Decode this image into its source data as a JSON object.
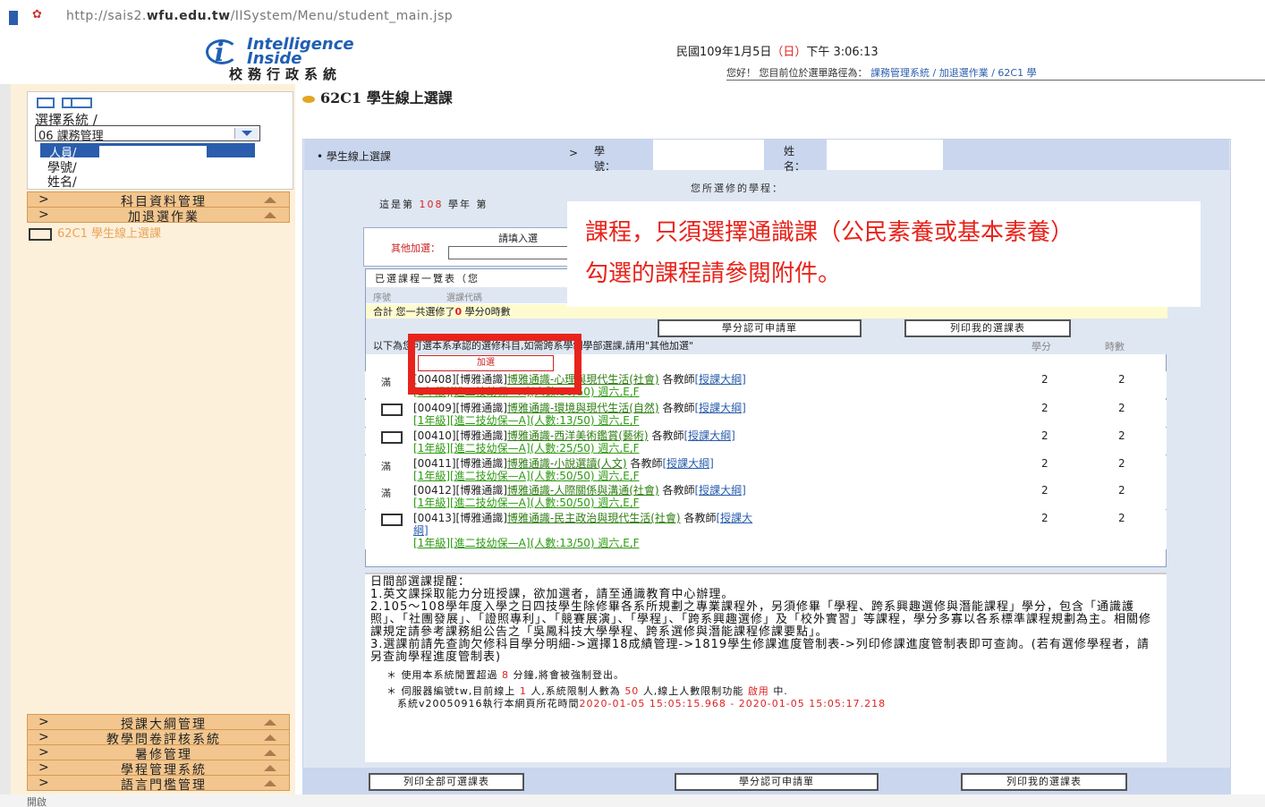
{
  "address_bar": {
    "url_prefix": "http://sais2.",
    "url_domain": "wfu.edu.tw",
    "url_suffix": "/IISystem/Menu/student_main.jsp"
  },
  "header": {
    "logo_line1": "Intelligence",
    "logo_line2": "Inside",
    "system_name": "校務行政系統",
    "date": "民國109年1月5日",
    "weekday": "（日）",
    "time": "下午 3:06:13",
    "path_label": "您好！ 您目前位於選單路徑為：",
    "path": "課務管理系統 / 加退選作業 / 62C1 學"
  },
  "sidebar": {
    "select_label": "選擇系統 /",
    "selected_system": "06 課務管理",
    "user_line": "人員/",
    "student_no_label": "學號/",
    "name_label": "姓名/",
    "menus_top": [
      {
        "arrow": ">",
        "label": "科目資料管理"
      },
      {
        "arrow": ">",
        "label": "加退選作業"
      }
    ],
    "sub_item": "62C1 學生線上選課",
    "menus_bottom": [
      {
        "arrow": ">",
        "label": "授課大綱管理"
      },
      {
        "arrow": ">",
        "label": "教學問卷評核系統"
      },
      {
        "arrow": ">",
        "label": "暑修管理"
      },
      {
        "arrow": ">",
        "label": "學程管理系統"
      },
      {
        "arrow": ">",
        "label": "語言門檻管理"
      }
    ]
  },
  "main": {
    "title": "62C1 學生線上選課",
    "bar_label": "• 學生線上選課",
    "bar_arrow": ">",
    "student_no_label": "學 號：",
    "student_name_label": "姓 名：",
    "intro_line1": "您所選修的學程：",
    "intro_prefix": "這是第",
    "intro_year": "108",
    "intro_mid": "學年  第",
    "other_add_hint": "請填入選",
    "other_add_label": "其他加選：",
    "callout_line1": "課程，只須選擇通識課（公民素養或基本素養）",
    "callout_line2": "勾選的課程請參閱附件。",
    "selected_header": "已選課程一覽表（您",
    "col_no": "序號",
    "col_code": "選課代碼",
    "total_prefix": "合計 您一共選修了",
    "total_credit": "0",
    "total_suffix": "學分0時數",
    "btn_print_all": "列印全部可選課表",
    "btn_credit_apply": "學分認可申請單",
    "btn_print_mine": "列印我的選課表",
    "list_header": "以下為您可選本系承認的選修科目,如需跨系學制學部選課,請用\"其他加選\"",
    "col_credits": "學分",
    "col_hours": "時數",
    "add_button": "加選",
    "courses": [
      {
        "status": "滿",
        "code": "[00408][博雅通識]",
        "name": "博雅通識-心理與現代生活(社會)",
        "teacher": "各教師",
        "syllabus": "[授課大綱]",
        "detail": "[1年級][進二技幼保—A](人數:50/50) 週六,E,F",
        "credits": "2",
        "hours": "2"
      },
      {
        "status": "",
        "code": "[00409][博雅通識]",
        "name": "博雅通識-環境與現代生活(自然)",
        "teacher": "各教師",
        "syllabus": "[授課大綱]",
        "detail": "[1年級][進二技幼保—A](人數:13/50) 週六,E,F",
        "credits": "2",
        "hours": "2"
      },
      {
        "status": "",
        "code": "[00410][博雅通識]",
        "name": "博雅通識-西洋美術鑑賞(藝術)",
        "teacher": "各教師",
        "syllabus": "[授課大綱]",
        "detail": "[1年級][進二技幼保—A](人數:25/50) 週六,E,F",
        "credits": "2",
        "hours": "2"
      },
      {
        "status": "滿",
        "code": "[00411][博雅通識]",
        "name": "博雅通識-小說選讀(人文)",
        "teacher": "各教師",
        "syllabus": "[授課大綱]",
        "detail": "[1年級][進二技幼保—A](人數:50/50) 週六,E,F",
        "credits": "2",
        "hours": "2"
      },
      {
        "status": "滿",
        "code": "[00412][博雅通識]",
        "name": "博雅通識-人際關係與溝通(社會)",
        "teacher": "各教師",
        "syllabus": "[授課大綱]",
        "detail": "[1年級][進二技幼保—A](人數:50/50) 週六,E,F",
        "credits": "2",
        "hours": "2"
      },
      {
        "status": "",
        "code": "[00413][博雅通識]",
        "name": "博雅通識-民主政治與現代生活(社會)",
        "teacher": "各教師",
        "syllabus": "[授課大",
        "detail": "綱]",
        "detail2": "[1年級][進二技幼保—A](人數:13/50) 週六,E,F",
        "credits": "2",
        "hours": "2"
      }
    ],
    "notes_title": "日間部選課提醒：",
    "notes": [
      "1.英文課採取能力分班授課，欲加選者，請至通識教育中心辦理。",
      "2.105～108學年度入學之日四技學生除修畢各系所規劃之專業課程外，另須修畢「學程、跨系興趣選修與潛能課程」學分，包含「通識護照」、「社團發展」、「證照專利」、「競賽展演」、「學程」、「跨系興趣選修」及「校外實習」等課程，學分多寡以各系標準課程規劃為主。相關修課規定請參考課務組公告之「吳鳳科技大學學程、跨系選修與潛能課程修課要點」。",
      "3.選課前請先查詢欠修科目學分明細->選擇18成績管理->1819學生修課進度管制表->列印修課進度管制表即可查詢。(若有選修學程者，請另查詢學程進度管制表)"
    ],
    "sys_notes": {
      "idle_prefix": "使用本系統閒置超過",
      "idle_minutes": "8",
      "idle_suffix": "分鐘,將會被強制登出。",
      "server_prefix": "伺服器編號tw,目前線上",
      "online": "1",
      "server_mid": "人,系統限制人數為",
      "limit": "50",
      "server_mid2": "人,線上人數限制功能",
      "enabled": "啟用",
      "server_suffix": "中.",
      "version_prefix": "系統v20050916執行本網頁所花時間",
      "timing": "2020-01-05 15:05:15.968 - 2020-01-05 15:05:17.218"
    }
  },
  "status_bar": "開啟"
}
